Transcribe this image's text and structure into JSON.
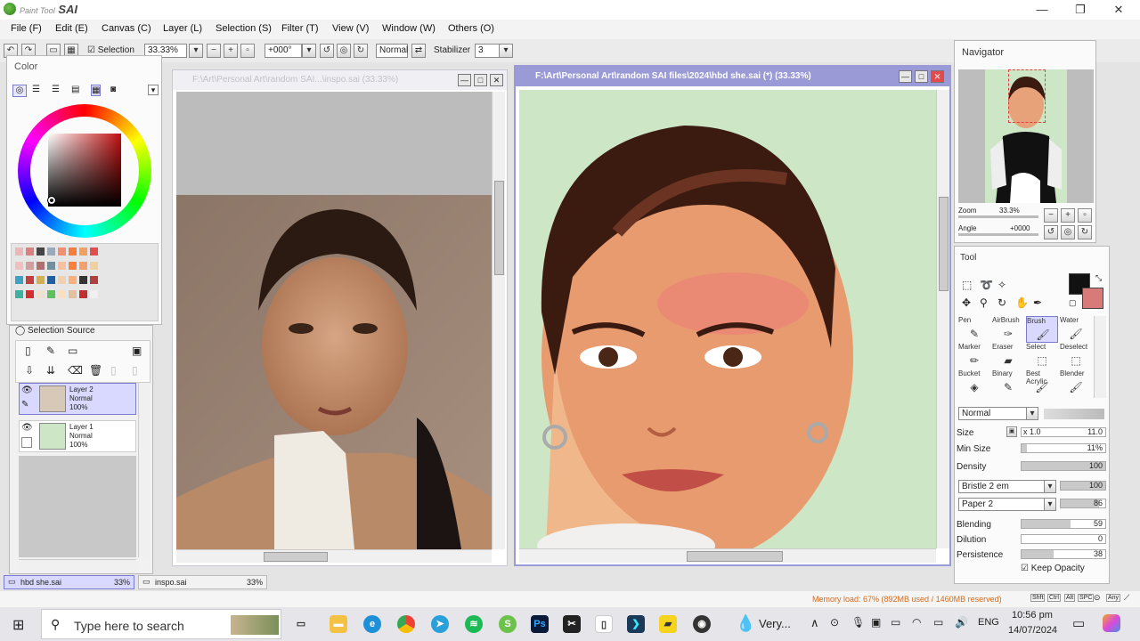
{
  "app": {
    "name": "Paint Tool SAI",
    "logo_text": "Paint Tool",
    "logo_brand": "SAI"
  },
  "window_controls": {
    "minimize": "—",
    "restore": "❐",
    "close": "✕"
  },
  "menu": [
    "File (F)",
    "Edit (E)",
    "Canvas (C)",
    "Layer (L)",
    "Selection (S)",
    "Filter (T)",
    "View (V)",
    "Window (W)",
    "Others (O)"
  ],
  "toolbar": {
    "selection_label": "Selection",
    "zoom": "33.33%",
    "rotation": "+000°",
    "blend_mode": "Normal",
    "stabilizer_label": "Stabilizer",
    "stabilizer_value": "3"
  },
  "color_panel": {
    "title": "Color"
  },
  "selection_source": {
    "label": "Selection Source"
  },
  "layers": [
    {
      "name": "Layer 2",
      "mode": "Normal",
      "opacity": "100%",
      "selected": true
    },
    {
      "name": "Layer 1",
      "mode": "Normal",
      "opacity": "100%",
      "selected": false
    }
  ],
  "doc_left": {
    "title": "F:\\Art\\Personal Art\\random SAI...\\inspo.sai (33.33%)"
  },
  "doc_right": {
    "title": "F:\\Art\\Personal Art\\random SAI files\\2024\\hbd she.sai (*) (33.33%)"
  },
  "navigator": {
    "title": "Navigator",
    "zoom_label": "Zoom",
    "zoom_value": "33.3%",
    "angle_label": "Angle",
    "angle_value": "+0000"
  },
  "tool_panel": {
    "title": "Tool",
    "tools": [
      "Pen",
      "AirBrush",
      "Brush",
      "Water",
      "Marker",
      "Eraser",
      "Select",
      "Deselect",
      "Bucket",
      "Binary",
      "Best Acrylic",
      "Blender"
    ],
    "blend_mode": "Normal",
    "size_label": "Size",
    "size_mult": "x 1.0",
    "size_value": "11.0",
    "min_size_label": "Min Size",
    "min_size_value": "11%",
    "density_label": "Density",
    "density_value": "100",
    "texture1": "Bristle 2 em",
    "texture1_value": "100",
    "texture2": "Paper 2",
    "texture2_value": "86",
    "blending_label": "Blending",
    "blending_value": "59",
    "dilution_label": "Dilution",
    "dilution_value": "0",
    "persistence_label": "Persistence",
    "persistence_value": "38",
    "keep_opacity_label": "Keep Opacity"
  },
  "doc_tabs": [
    {
      "name": "hbd she.sai",
      "zoom": "33%"
    },
    {
      "name": "inspo.sai",
      "zoom": "33%"
    }
  ],
  "status": {
    "memory": "Memory load: 67% (892MB used / 1460MB reserved)",
    "keys": [
      "Shft",
      "Ctrl",
      "Alt",
      "SPC",
      "⊙",
      "Any",
      "⟋"
    ]
  },
  "taskbar": {
    "search_placeholder": "Type here to search",
    "weather": "Very...",
    "language": "ENG",
    "time": "10:56 pm",
    "date": "14/07/2024"
  },
  "colors": {
    "accent": "#9a9ad6",
    "canvas_bg": "#cde6c6",
    "fg_color": "#111111",
    "bg_color": "#d97a7a",
    "memory_text": "#d46a1a"
  }
}
